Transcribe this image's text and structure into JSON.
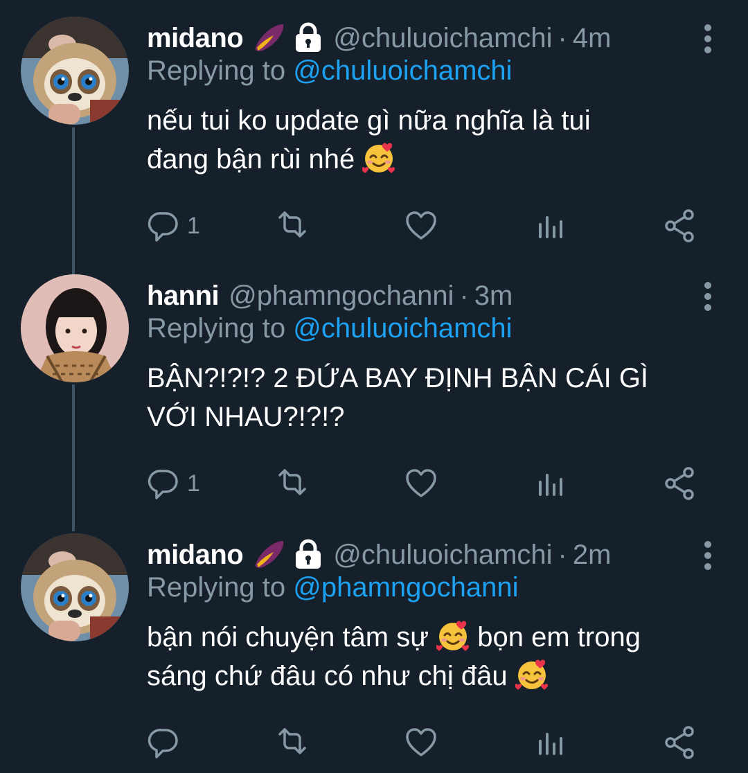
{
  "tweets": [
    {
      "name": "midano",
      "badges": [
        "sweet-potato-icon",
        "lock-icon"
      ],
      "handle": "@chuluoichamchi",
      "time": "4m",
      "reply_prefix": "Replying to ",
      "reply_to": "@chuluoichamchi",
      "text_line1": "nếu tui ko update gì nữa nghĩa là tui",
      "text_line2": "đang bận rùi nhé",
      "text_line2_emoji": "smiling-face-with-hearts-icon",
      "reply_count": "1"
    },
    {
      "name": "hanni",
      "handle": "@phamngochanni",
      "time": "3m",
      "reply_prefix": "Replying to ",
      "reply_to": "@chuluoichamchi",
      "text_line1": "BẬN?!?!? 2 ĐỨA BAY ĐỊNH BẬN CÁI GÌ",
      "text_line2": "VỚI NHAU?!?!?",
      "reply_count": "1"
    },
    {
      "name": "midano",
      "badges": [
        "sweet-potato-icon",
        "lock-icon"
      ],
      "handle": "@chuluoichamchi",
      "time": "2m",
      "reply_prefix": "Replying to ",
      "reply_to": "@phamngochanni",
      "text_line1a": "bận nói chuyện tâm sự",
      "text_line1b": "bọn em trong",
      "text_line2": "sáng chứ đâu có như chị đâu",
      "reply_count": ""
    }
  ],
  "separator": "·",
  "colors": {
    "background": "#15202b",
    "secondary_text": "#8899a6",
    "link": "#1da1f2",
    "thread_line": "#3d5466"
  }
}
